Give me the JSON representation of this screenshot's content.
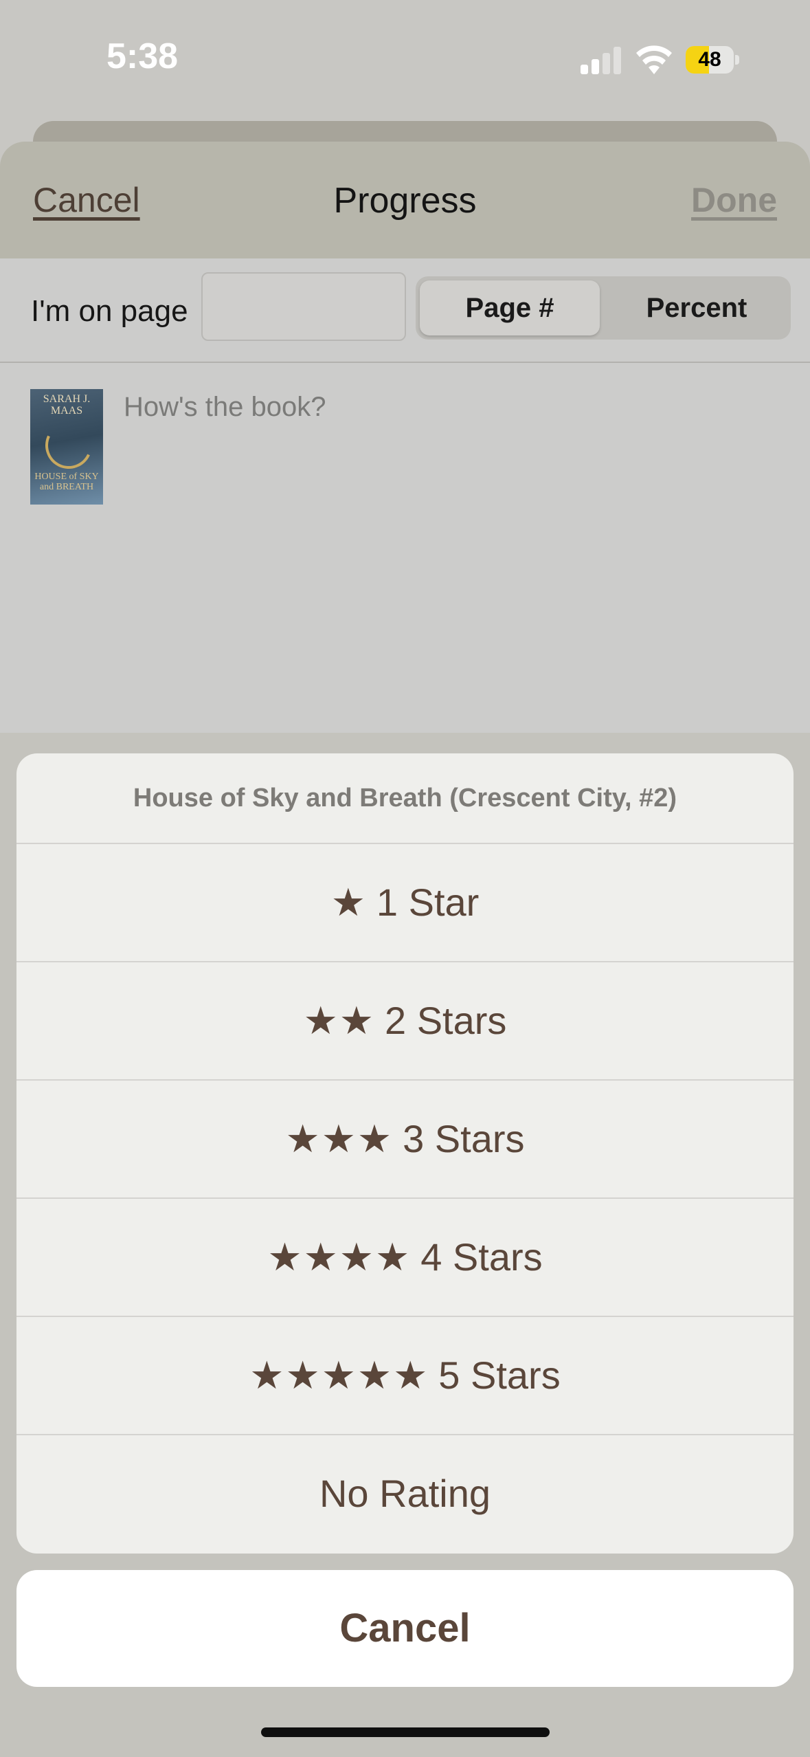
{
  "status_bar": {
    "time": "5:38",
    "battery_level": "48",
    "battery_fraction": 0.48
  },
  "nav": {
    "cancel_label": "Cancel",
    "title": "Progress",
    "done_label": "Done"
  },
  "progress": {
    "page_label": "I'm on page",
    "page_value": "",
    "mode_options": [
      "Page #",
      "Percent"
    ],
    "selected_mode": "Page #"
  },
  "book": {
    "cover_author": "SARAH J. MAAS",
    "cover_title": "HOUSE of SKY and BREATH",
    "review_placeholder": "How's the book?"
  },
  "rating_sheet": {
    "header": "House of Sky and Breath (Crescent City, #2)",
    "options": [
      {
        "stars": "★",
        "label": "1 Star"
      },
      {
        "stars": "★★",
        "label": "2 Stars"
      },
      {
        "stars": "★★★",
        "label": "3 Stars"
      },
      {
        "stars": "★★★★",
        "label": "4 Stars"
      },
      {
        "stars": "★★★★★",
        "label": "5 Stars"
      },
      {
        "stars": "",
        "label": "No Rating"
      }
    ],
    "cancel_label": "Cancel"
  },
  "icons": {
    "signal": "cellular-signal-icon",
    "wifi": "wifi-icon",
    "battery": "battery-icon"
  }
}
